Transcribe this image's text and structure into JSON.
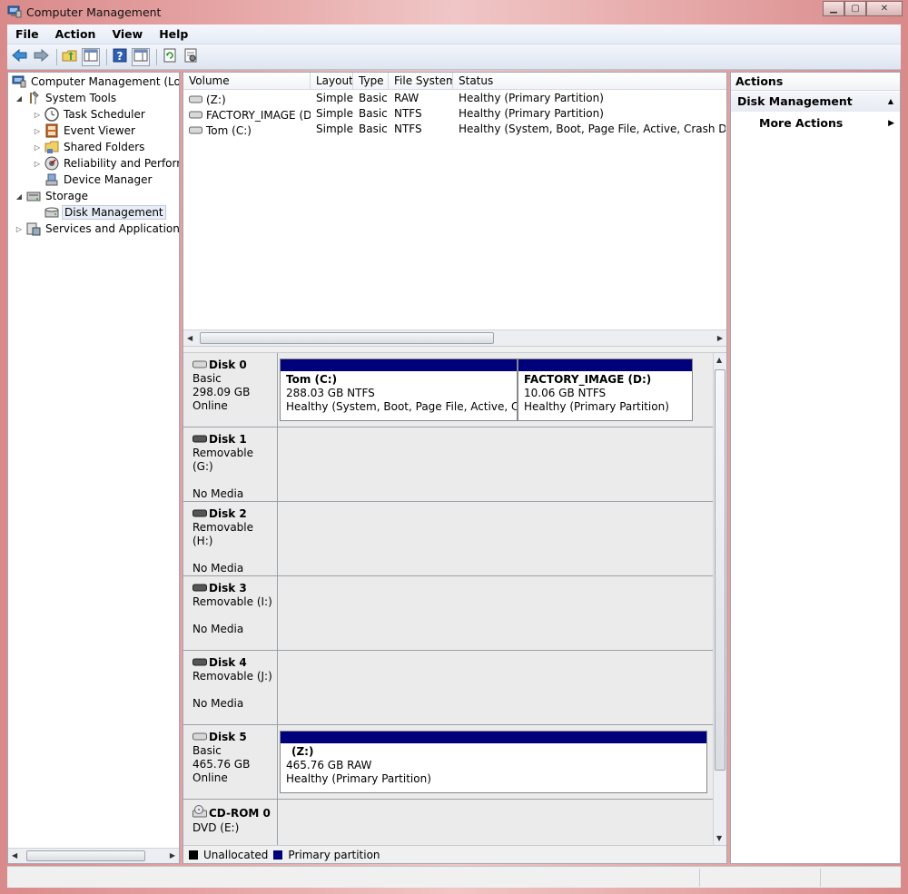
{
  "window": {
    "title": "Computer Management"
  },
  "menu": [
    "File",
    "Action",
    "View",
    "Help"
  ],
  "toolbar_icons": [
    "back-icon",
    "forward-icon",
    "up-folder-icon",
    "show-hide-tree-icon",
    "help-icon",
    "show-hide-action-pane-icon",
    "refresh-icon",
    "properties-icon"
  ],
  "tree": {
    "root": "Computer Management (Local",
    "system_tools": "System Tools",
    "task_scheduler": "Task Scheduler",
    "event_viewer": "Event Viewer",
    "shared_folders": "Shared Folders",
    "reliability": "Reliability and Performa",
    "device_manager": "Device Manager",
    "storage": "Storage",
    "disk_management": "Disk Management",
    "services": "Services and Applications"
  },
  "volumes": {
    "headers": {
      "volume": "Volume",
      "layout": "Layout",
      "type": "Type",
      "fs": "File System",
      "status": "Status"
    },
    "rows": [
      {
        "volume": "(Z:)",
        "layout": "Simple",
        "type": "Basic",
        "fs": "RAW",
        "status": "Healthy (Primary Partition)"
      },
      {
        "volume": "FACTORY_IMAGE (D:)",
        "layout": "Simple",
        "type": "Basic",
        "fs": "NTFS",
        "status": "Healthy (Primary Partition)"
      },
      {
        "volume": "Tom (C:)",
        "layout": "Simple",
        "type": "Basic",
        "fs": "NTFS",
        "status": "Healthy (System, Boot, Page File, Active, Crash Dump, P"
      }
    ]
  },
  "disks": [
    {
      "name": "Disk 0",
      "l1": "Basic",
      "l2": "298.09 GB",
      "l3": "Online",
      "partitions": [
        {
          "title": "Tom  (C:)",
          "size": "288.03 GB NTFS",
          "status": "Healthy (System, Boot, Page File, Active, Crash"
        },
        {
          "title": "FACTORY_IMAGE  (D:)",
          "size": "10.06 GB NTFS",
          "status": "Healthy (Primary Partition)"
        }
      ]
    },
    {
      "name": "Disk 1",
      "l1": "Removable (G:)",
      "l2": "",
      "l3": "No Media"
    },
    {
      "name": "Disk 2",
      "l1": "Removable (H:)",
      "l2": "",
      "l3": "No Media"
    },
    {
      "name": "Disk 3",
      "l1": "Removable (I:)",
      "l2": "",
      "l3": "No Media"
    },
    {
      "name": "Disk 4",
      "l1": "Removable (J:)",
      "l2": "",
      "l3": "No Media"
    },
    {
      "name": "Disk 5",
      "l1": "Basic",
      "l2": "465.76 GB",
      "l3": "Online",
      "partitions": [
        {
          "title": "(Z:)",
          "size": "465.76 GB RAW",
          "status": "Healthy (Primary Partition)"
        }
      ]
    },
    {
      "name": "CD-ROM 0",
      "l1": "DVD (E:)",
      "l2": "",
      "l3": ""
    }
  ],
  "legend": {
    "unallocated": "Unallocated",
    "primary": "Primary partition",
    "unallocated_color": "#000000",
    "primary_color": "#00007b"
  },
  "actions": {
    "title": "Actions",
    "group": "Disk Management",
    "more": "More Actions"
  }
}
